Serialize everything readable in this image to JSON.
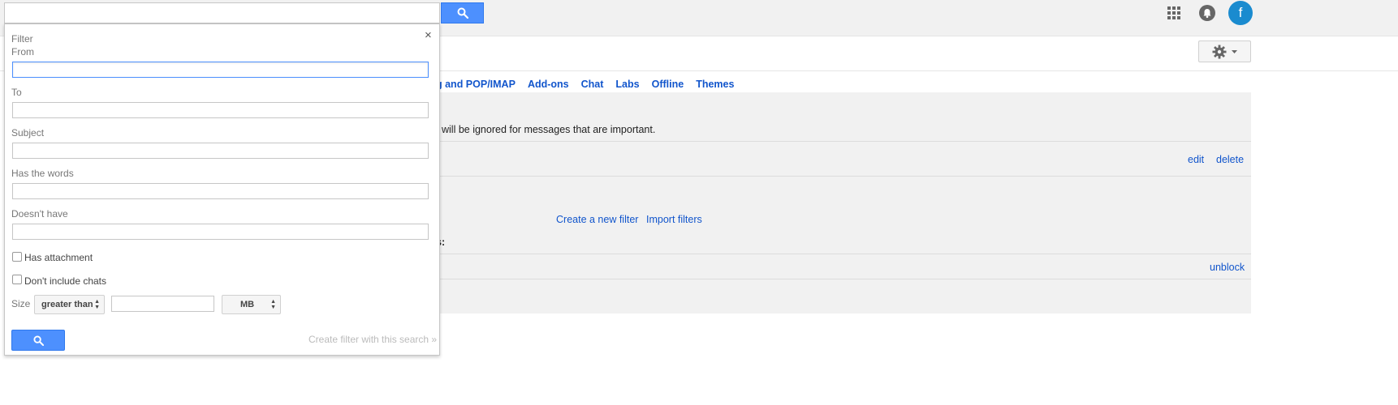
{
  "topbar": {
    "search_value": "",
    "avatar_letter": "f"
  },
  "tabs": [
    {
      "label": "g and POP/IMAP"
    },
    {
      "label": "Add-ons"
    },
    {
      "label": "Chat"
    },
    {
      "label": "Labs"
    },
    {
      "label": "Offline"
    },
    {
      "label": "Themes"
    }
  ],
  "panel": {
    "important_note": "will be ignored for messages that are important.",
    "edit": "edit",
    "delete": "delete",
    "create_filter": "Create a new filter",
    "import_filters": "Import filters",
    "blocked_label_tail": "s:",
    "unblock": "unblock"
  },
  "filter": {
    "title": "Filter",
    "close": "×",
    "from_label": "From",
    "from_value": "",
    "to_label": "To",
    "to_value": "",
    "subject_label": "Subject",
    "subject_value": "",
    "has_words_label": "Has the words",
    "has_words_value": "",
    "doesnt_have_label": "Doesn't have",
    "doesnt_have_value": "",
    "has_attachment_label": "Has attachment",
    "has_attachment_checked": false,
    "no_chats_label": "Don't include chats",
    "no_chats_checked": false,
    "size_label": "Size",
    "size_operator": "greater than",
    "size_value": "",
    "size_unit": "MB",
    "create_filter_link": "Create filter with this search »"
  },
  "colors": {
    "accent": "#4d90fe",
    "link": "#1155cc",
    "avatar": "#1a8bcf"
  }
}
